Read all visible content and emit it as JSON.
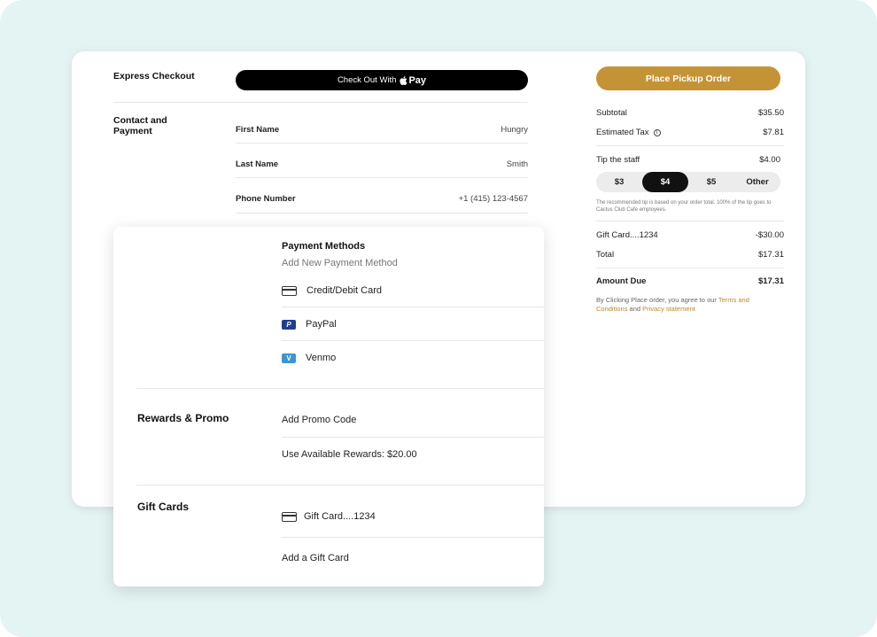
{
  "express": {
    "label": "Express Checkout",
    "button_label": "Check Out With",
    "pay_label": "Pay"
  },
  "contact": {
    "label": "Contact and Payment",
    "fields": [
      {
        "label": "First Name",
        "value": "Hungry"
      },
      {
        "label": "Last Name",
        "value": "Smith"
      },
      {
        "label": "Phone Number",
        "value": "+1 (415) 123-4567"
      }
    ]
  },
  "summary": {
    "place_order_label": "Place Pickup Order",
    "subtotal_label": "Subtotal",
    "subtotal_value": "$35.50",
    "tax_label": "Estimated Tax",
    "tax_value": "$7.81",
    "tip_label": "Tip the staff",
    "tip_value": "$4.00",
    "tip_options": [
      "$3",
      "$4",
      "$5",
      "Other"
    ],
    "tip_selected": "$4",
    "tip_note": "The recommended tip is based on your order total. 100% of the tip goes to Cactus Club Cafe employees.",
    "giftcard_label": "Gift Card....1234",
    "giftcard_value": "-$30.00",
    "total_label": "Total",
    "total_value": "$17.31",
    "amount_due_label": "Amount Due",
    "amount_due_value": "$17.31",
    "legal_prefix": "By Clicking Place order, you agree to our",
    "terms_link": "Terms and Conditions",
    "legal_and": "and",
    "privacy_link": "Privacy statement"
  },
  "payment": {
    "title": "Payment Methods",
    "add_new": "Add New Payment Method",
    "methods": [
      {
        "label": "Credit/Debit Card",
        "icon": "credit-card-icon"
      },
      {
        "label": "PayPal",
        "icon": "paypal-icon"
      },
      {
        "label": "Venmo",
        "icon": "venmo-icon"
      }
    ]
  },
  "rewards": {
    "label": "Rewards & Promo",
    "add_promo": "Add Promo Code",
    "use_rewards": "Use Available Rewards: $20.00"
  },
  "giftcards": {
    "label": "Gift Cards",
    "card": "Gift Card....1234",
    "add": "Add a Gift Card"
  },
  "colors": {
    "background": "#e4f4f3",
    "accent": "#c49335",
    "dark": "#111111"
  }
}
